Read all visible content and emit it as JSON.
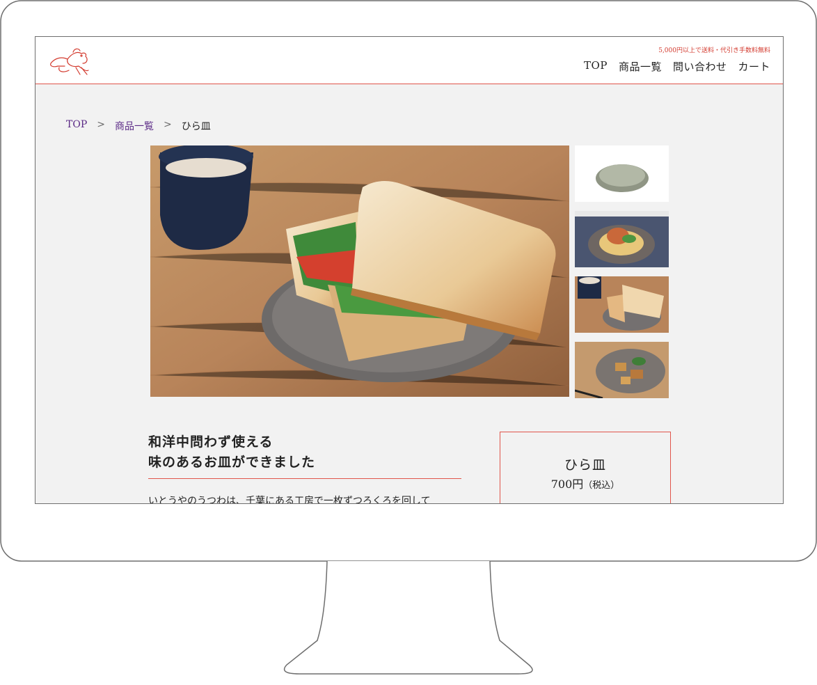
{
  "header": {
    "shipping_note": "5,000円以上で送料・代引き手数料無料",
    "nav": [
      "TOP",
      "商品一覧",
      "問い合わせ",
      "カート"
    ]
  },
  "breadcrumb": {
    "items": [
      "TOP",
      "商品一覧",
      "ひら皿"
    ],
    "separator": ">"
  },
  "gallery": {
    "main_alt": "sandwich on plate with cup",
    "thumbnails": [
      "plate",
      "pasta dish",
      "sandwich",
      "stir-fry"
    ]
  },
  "description": {
    "heading_line1": "和洋中問わず使える",
    "heading_line2": "味のあるお皿ができました",
    "body": "いとうやのうつわは、千葉にある工房で一枚ずつろくろを回して"
  },
  "product": {
    "name": "ひら皿",
    "price": "700円",
    "tax_note": "（税込）"
  },
  "colors": {
    "accent": "#e0544a",
    "link": "#5b2a86",
    "background": "#f2f2f2"
  }
}
